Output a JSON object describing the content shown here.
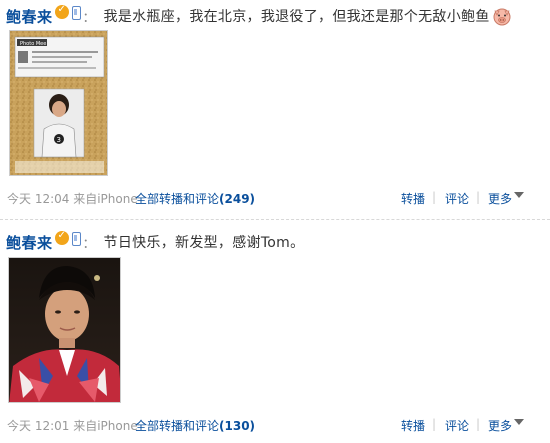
{
  "posts": [
    {
      "author": "鲍春来",
      "colon": "：",
      "text": "我是水瓶座，我在北京，我退役了，但我还是那个无敌小鲍鱼",
      "emoji": "pig-face-icon",
      "image_caption": "Photo Mee",
      "timestamp": "今天 12:04 来自iPhone",
      "repost_comment_label": "全部转播和评论",
      "repost_comment_count": "(249)",
      "actions": {
        "repost": "转播",
        "comment": "评论",
        "more": "更多"
      }
    },
    {
      "author": "鲍春来",
      "colon": "：",
      "text": "节日快乐，新发型，感谢Tom。",
      "timestamp": "今天 12:01 来自iPhone",
      "repost_comment_label": "全部转播和评论",
      "repost_comment_count": "(130)",
      "actions": {
        "repost": "转播",
        "comment": "评论",
        "more": "更多"
      }
    }
  ],
  "colors": {
    "author": "#0a4f9c",
    "link": "#0a4f9c",
    "meta": "#999999",
    "badge": "#f2a51a"
  }
}
